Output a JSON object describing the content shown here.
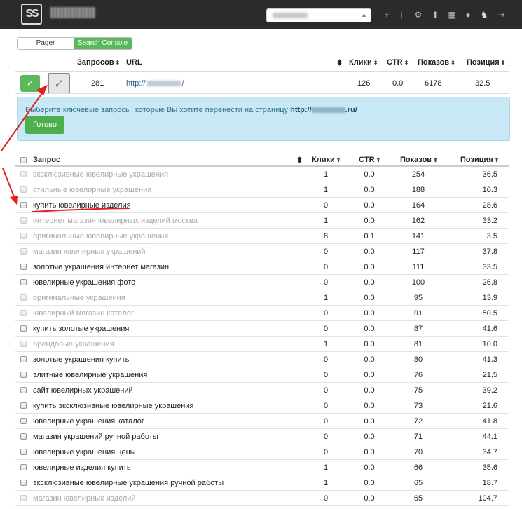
{
  "topbar": {
    "logo_text": "SS",
    "icons": [
      "plus-icon",
      "info-icon",
      "gears-icon",
      "upload-icon",
      "grid-icon",
      "user-icon",
      "linux-icon",
      "logout-icon"
    ],
    "icon_glyphs": [
      "+",
      "i",
      "⚙",
      "⬆",
      "▦",
      "●",
      "♞",
      "⇥"
    ]
  },
  "tabs": {
    "pager": "Pager",
    "search_console": "Search Console",
    "active": "Search Console"
  },
  "url_table": {
    "headers": {
      "queries": "Запросов",
      "url": "URL",
      "clicks": "Клики",
      "ctr": "CTR",
      "shows": "Показов",
      "position": "Позиция"
    },
    "row": {
      "queries": "281",
      "url_prefix": "http://",
      "url_suffix": "/",
      "clicks": "126",
      "ctr": "0.0",
      "shows": "6178",
      "position": "32.5"
    },
    "ok_glyph": "✓",
    "expand_glyph": "⤢"
  },
  "info": {
    "text_prefix": "Выберите ключевые запросы, которые Вы хотите перенести на страницу",
    "domain_prefix": "http://",
    "domain_suffix": ".ru/",
    "done_label": "Готово"
  },
  "query_table": {
    "headers": {
      "query": "Запрос",
      "clicks": "Клики",
      "ctr": "CTR",
      "shows": "Показов",
      "position": "Позиция"
    },
    "rows": [
      {
        "q": "эксклюзивные ювелирные украшения",
        "clicks": "1",
        "ctr": "0.0",
        "shows": "254",
        "pos": "36.5",
        "dim": true
      },
      {
        "q": "стильные ювелирные украшения",
        "clicks": "1",
        "ctr": "0.0",
        "shows": "188",
        "pos": "10.3",
        "dim": true
      },
      {
        "q": "купить ювелирные изделия",
        "clicks": "0",
        "ctr": "0.0",
        "shows": "164",
        "pos": "28.6",
        "dim": false
      },
      {
        "q": "интернет магазин ювелирных изделий москва",
        "clicks": "1",
        "ctr": "0.0",
        "shows": "162",
        "pos": "33.2",
        "dim": true
      },
      {
        "q": "оригинальные ювелирные украшения",
        "clicks": "8",
        "ctr": "0.1",
        "shows": "141",
        "pos": "3.5",
        "dim": true
      },
      {
        "q": "магазин ювелирных украшений",
        "clicks": "0",
        "ctr": "0.0",
        "shows": "117",
        "pos": "37.8",
        "dim": true
      },
      {
        "q": "золотые украшения интернет магазин",
        "clicks": "0",
        "ctr": "0.0",
        "shows": "111",
        "pos": "33.5",
        "dim": false
      },
      {
        "q": "ювелирные украшения фото",
        "clicks": "0",
        "ctr": "0.0",
        "shows": "100",
        "pos": "26.8",
        "dim": false
      },
      {
        "q": "оригинальные украшения",
        "clicks": "1",
        "ctr": "0.0",
        "shows": "95",
        "pos": "13.9",
        "dim": true
      },
      {
        "q": "ювелирный магазин каталог",
        "clicks": "0",
        "ctr": "0.0",
        "shows": "91",
        "pos": "50.5",
        "dim": true
      },
      {
        "q": "купить золотые украшения",
        "clicks": "0",
        "ctr": "0.0",
        "shows": "87",
        "pos": "41.6",
        "dim": false
      },
      {
        "q": "брендовые украшения",
        "clicks": "1",
        "ctr": "0.0",
        "shows": "81",
        "pos": "10.0",
        "dim": true
      },
      {
        "q": "золотые украшения купить",
        "clicks": "0",
        "ctr": "0.0",
        "shows": "80",
        "pos": "41.3",
        "dim": false
      },
      {
        "q": "элитные ювелирные украшения",
        "clicks": "0",
        "ctr": "0.0",
        "shows": "76",
        "pos": "21.5",
        "dim": false
      },
      {
        "q": "сайт ювелирных украшений",
        "clicks": "0",
        "ctr": "0.0",
        "shows": "75",
        "pos": "39.2",
        "dim": false
      },
      {
        "q": "купить эксклюзивные ювелирные украшения",
        "clicks": "0",
        "ctr": "0.0",
        "shows": "73",
        "pos": "21.6",
        "dim": false
      },
      {
        "q": "ювелирные украшения каталог",
        "clicks": "0",
        "ctr": "0.0",
        "shows": "72",
        "pos": "41.8",
        "dim": false
      },
      {
        "q": "магазин украшений ручной работы",
        "clicks": "0",
        "ctr": "0.0",
        "shows": "71",
        "pos": "44.1",
        "dim": false
      },
      {
        "q": "ювелирные украшения цены",
        "clicks": "0",
        "ctr": "0.0",
        "shows": "70",
        "pos": "34.7",
        "dim": false
      },
      {
        "q": "ювелирные изделия купить",
        "clicks": "1",
        "ctr": "0.0",
        "shows": "66",
        "pos": "35.6",
        "dim": false
      },
      {
        "q": "эксклюзивные ювелирные украшения ручной работы",
        "clicks": "1",
        "ctr": "0.0",
        "shows": "65",
        "pos": "18.7",
        "dim": false
      },
      {
        "q": "магазин ювелирных изделий",
        "clicks": "0",
        "ctr": "0.0",
        "shows": "65",
        "pos": "104.7",
        "dim": true
      }
    ]
  },
  "sort_glyph": "⬍",
  "colors": {
    "green": "#5cb85c",
    "annotation_red": "#e02020",
    "info_bg": "#c9e8f6"
  }
}
